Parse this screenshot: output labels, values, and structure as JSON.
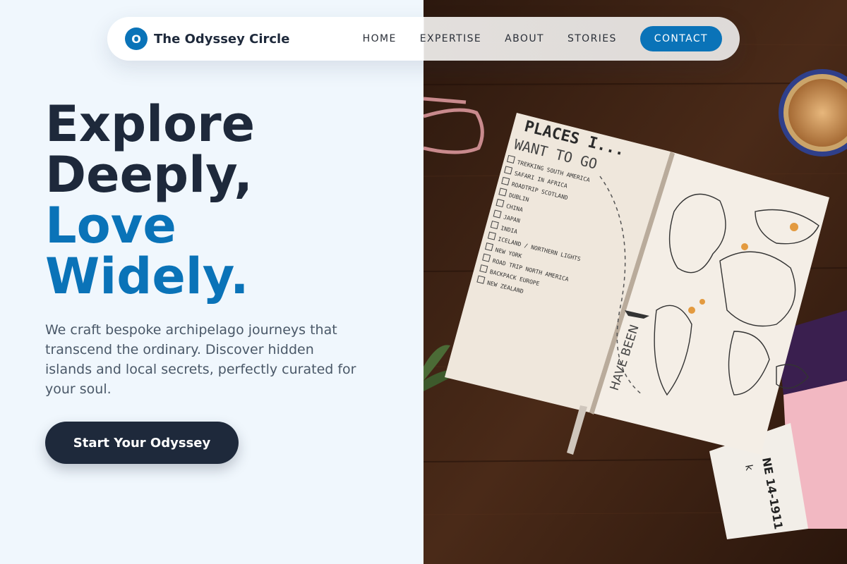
{
  "brand": {
    "logo_letter": "O",
    "name": "The Odyssey Circle"
  },
  "nav": {
    "items": [
      {
        "label": "HOME"
      },
      {
        "label": "EXPERTISE"
      },
      {
        "label": "ABOUT"
      },
      {
        "label": "STORIES"
      }
    ],
    "contact_label": "CONTACT"
  },
  "hero": {
    "title_line1": "Explore",
    "title_line2": "Deeply,",
    "title_line3": "Love",
    "title_line4": "Widely.",
    "description": "We craft bespoke archipelago journeys that transcend the ordinary. Discover hidden islands and local secrets, perfectly curated for your soul.",
    "cta_label": "Start Your Odyssey"
  },
  "photo": {
    "notebook_heading_1": "PLACES I...",
    "notebook_heading_2": "WANT TO GO",
    "checklist": [
      "TREKKING SOUTH AMERICA",
      "SAFARI IN AFRICA",
      "ROADTRIP SCOTLAND",
      "DUBLIN",
      "CHINA",
      "JAPAN",
      "INDIA",
      "ICELAND / NORTHERN LIGHTS",
      "NEW YORK",
      "ROAD TRIP NORTH AMERICA",
      "BACKPACK EUROPE",
      "NEW ZEALAND"
    ],
    "have_been_label": "HAVE BEEN",
    "card_text": "NE 14-1911",
    "card_letter": "k",
    "colors": {
      "wood": "#3a2114",
      "paper": "#efe7dc",
      "pink_card": "#f2b8c2",
      "purple_card": "#3a1f4f"
    }
  },
  "theme": {
    "accent": "#0a73b8",
    "dark": "#1e293b",
    "text_muted": "#4a5868"
  }
}
